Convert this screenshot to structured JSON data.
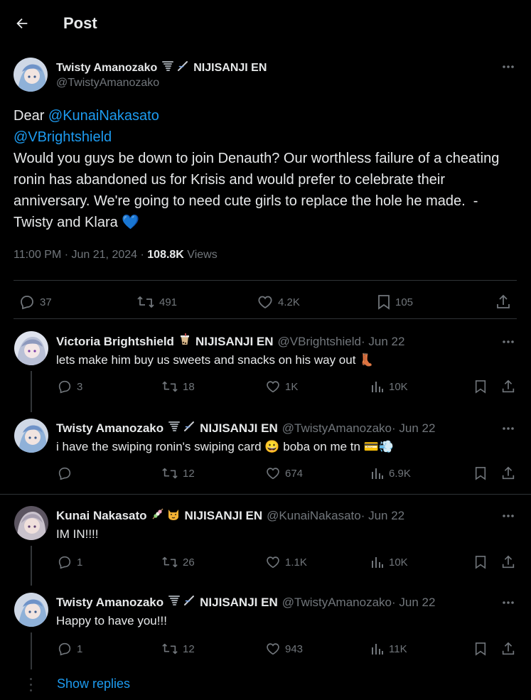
{
  "header": {
    "title": "Post"
  },
  "main_post": {
    "display_name": "Twisty Amanozako",
    "org": "NIJISANJI EN",
    "handle": "@TwistyAmanozako",
    "text_prefix": "Dear ",
    "mention1": "@KunaiNakasato",
    "mention2": "@VBrightshield",
    "body": "Would you guys be down to join Denauth? Our worthless failure of a cheating ronin has abandoned us for Krisis and would prefer to celebrate their anniversary. We're going to need cute girls to replace the hole he made.  -Twisty and Klara ",
    "heart_emoji": "💙",
    "timestamp": "11:00 PM · Jun 21, 2024 · ",
    "views_count": "108.8K",
    "views_label": " Views",
    "replies": "37",
    "reposts": "491",
    "likes": "4.2K",
    "bookmarks": "105"
  },
  "replies": [
    {
      "display_name": "Victoria Brightshield",
      "org": "NIJISANJI EN",
      "handle": "@VBrightshield",
      "date": " · Jun 22",
      "text": "lets make him buy us sweets and snacks on his way out",
      "emoji": "👢",
      "replies": "3",
      "reposts": "18",
      "likes": "1K",
      "views": "10K"
    },
    {
      "display_name": "Twisty Amanozako",
      "org": "NIJISANJI EN",
      "handle": "@TwistyAmanozako",
      "date": " · Jun 22",
      "text": "i have the swiping ronin's swiping card",
      "emoji": "😀",
      "text2": "boba on me tn",
      "emoji2": "💳💨",
      "replies": "",
      "reposts": "12",
      "likes": "674",
      "views": "6.9K"
    },
    {
      "display_name": "Kunai Nakasato",
      "org": "NIJISANJI EN",
      "handle": "@KunaiNakasato",
      "date": " · Jun 22",
      "text": "IM IN!!!!",
      "replies": "1",
      "reposts": "26",
      "likes": "1.1K",
      "views": "10K"
    },
    {
      "display_name": "Twisty Amanozako",
      "org": "NIJISANJI EN",
      "handle": "@TwistyAmanozako",
      "date": " · Jun 22",
      "text": "Happy to have you!!!",
      "replies": "1",
      "reposts": "12",
      "likes": "943",
      "views": "11K"
    }
  ],
  "show_replies": "Show replies",
  "colors": {
    "accent": "#1d9bf0",
    "muted": "#71767b",
    "text": "#e7e9ea",
    "bg": "#000000"
  }
}
